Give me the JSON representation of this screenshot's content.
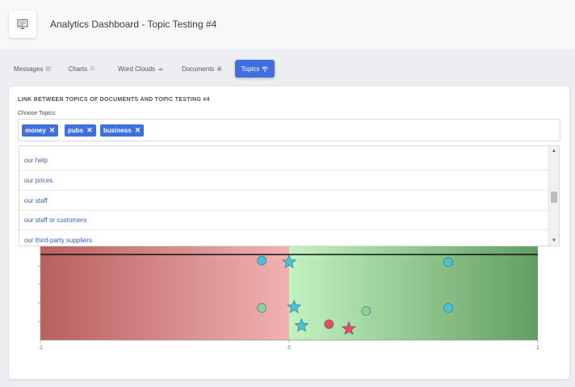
{
  "header": {
    "title": "Analytics Dashboard - Topic Testing #4",
    "logo_icon": "presentation-board-icon"
  },
  "tabs": [
    {
      "label": "Messages",
      "icon": "message-icon",
      "active": false
    },
    {
      "label": "Charts",
      "icon": "chart-icon",
      "active": false
    },
    {
      "label": "Word Clouds",
      "icon": "cloud-icon",
      "active": false
    },
    {
      "label": "Documents",
      "icon": "document-icon",
      "active": false
    },
    {
      "label": "Topics",
      "icon": "wifi-icon",
      "active": true
    }
  ],
  "card": {
    "title": "LINK BETWEEN TOPICS OF DOCUMENTS AND TOPIC TESTING #4",
    "choose_label": "Choose Topics:"
  },
  "selected_topics": [
    "money",
    "pubs",
    "business"
  ],
  "dropdown_items": [
    "our help",
    "our prices",
    "our staff",
    "our staff or customers",
    "our third-party suppliers"
  ],
  "colors": {
    "accent": "#3f6fe0",
    "negative_zone": "#c06868",
    "positive_zone": "#6aa86a",
    "cyan_marker": "#45c3db",
    "green_marker": "#8fcf9a",
    "red_marker": "#ee4a5e"
  },
  "chart_data": {
    "type": "scatter",
    "xlim": [
      -1,
      1
    ],
    "x_ticks": [
      "-1",
      "0",
      "1"
    ],
    "series": [
      {
        "marker": "circle",
        "color": "cyan",
        "points": [
          [
            -0.11,
            0.88
          ],
          [
            0.64,
            0.86
          ],
          [
            0.64,
            0.27
          ]
        ]
      },
      {
        "marker": "star",
        "color": "cyan",
        "points": [
          [
            0.0,
            0.86
          ],
          [
            0.02,
            0.28
          ],
          [
            0.05,
            0.04
          ]
        ]
      },
      {
        "marker": "circle",
        "color": "green",
        "points": [
          [
            -0.11,
            0.27
          ],
          [
            0.31,
            0.23
          ]
        ]
      },
      {
        "marker": "circle",
        "color": "red",
        "points": [
          [
            0.16,
            0.06
          ]
        ]
      },
      {
        "marker": "star",
        "color": "red",
        "points": [
          [
            0.24,
            0.0
          ]
        ]
      }
    ]
  }
}
